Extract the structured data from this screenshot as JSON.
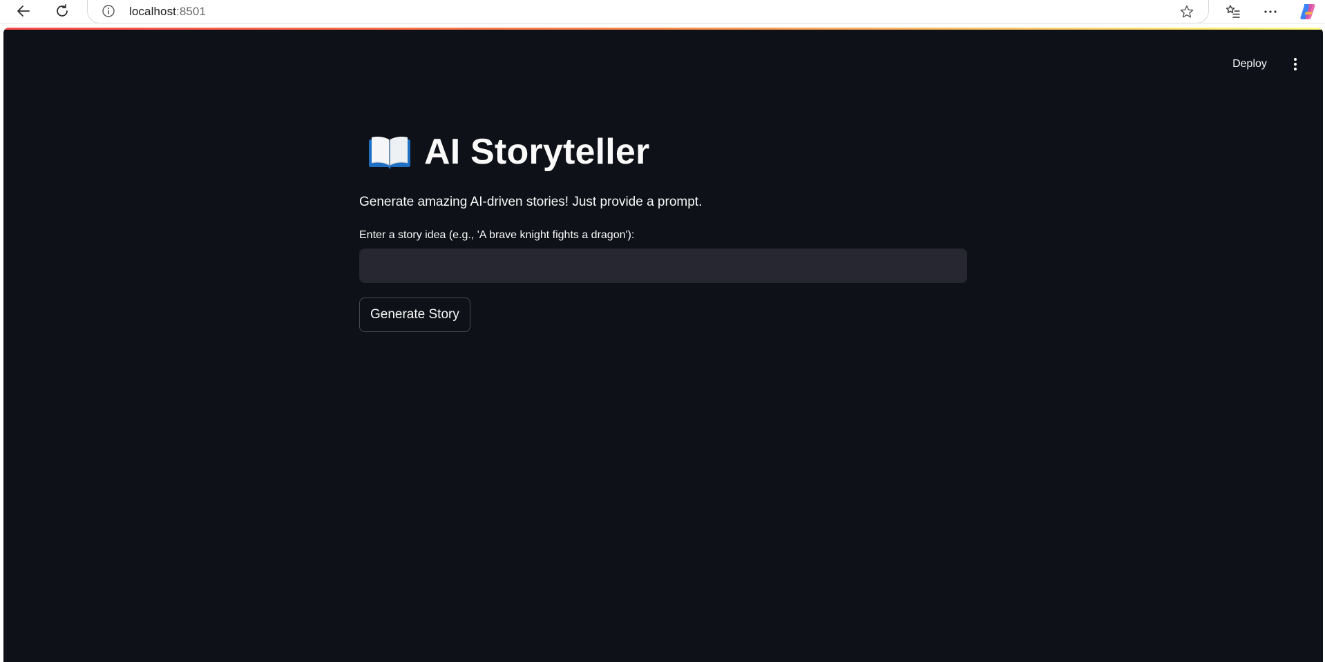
{
  "browser": {
    "url_host": "localhost",
    "url_port": ":8501"
  },
  "toolbar": {
    "deploy_label": "Deploy"
  },
  "main": {
    "title": "AI Storyteller",
    "subtitle": "Generate amazing AI-driven stories! Just provide a prompt.",
    "input_label": "Enter a story idea (e.g., 'A brave knight fights a dragon'):",
    "input_value": "",
    "button_label": "Generate Story"
  },
  "colors": {
    "app_background": "#0e1117",
    "input_background": "#262730",
    "text": "#fafafa",
    "accent_gradient_start": "#ff4b4b",
    "accent_gradient_end": "#fffd80"
  }
}
